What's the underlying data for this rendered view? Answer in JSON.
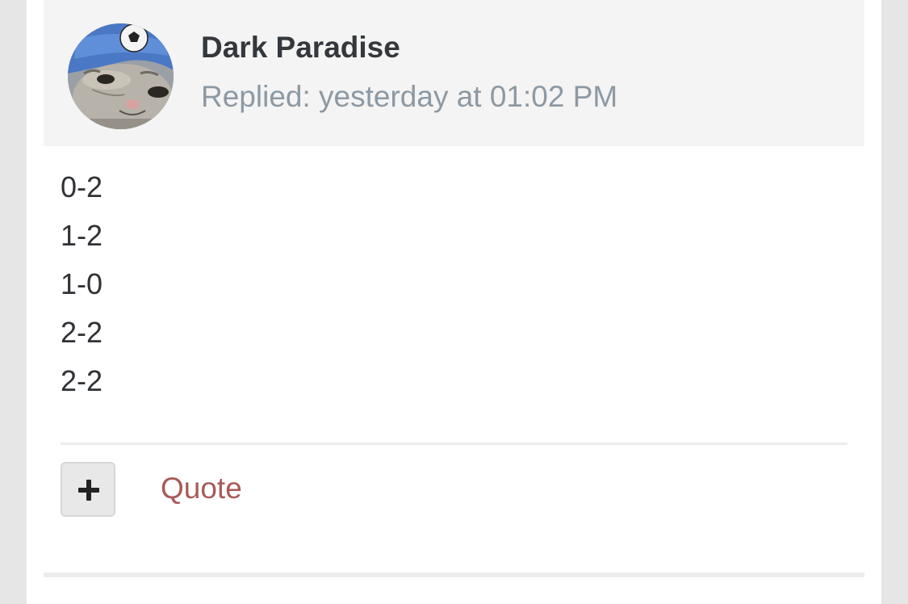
{
  "post": {
    "author": "Dark Paradise",
    "reply_time": "Replied: yesterday at 01:02 PM",
    "avatar_icon": "cat-with-soccer-ball-hat-avatar",
    "body_lines": [
      "0-2",
      "1-2",
      "1-0",
      "2-2",
      "2-2"
    ]
  },
  "actions": {
    "expand_icon": "plus-icon",
    "quote_label": "Quote"
  },
  "colors": {
    "background": "#e6e6e6",
    "header_bg": "#f4f4f4",
    "author": "#34383c",
    "timestamp": "#8d99a3",
    "quote_link": "#a85a58"
  }
}
